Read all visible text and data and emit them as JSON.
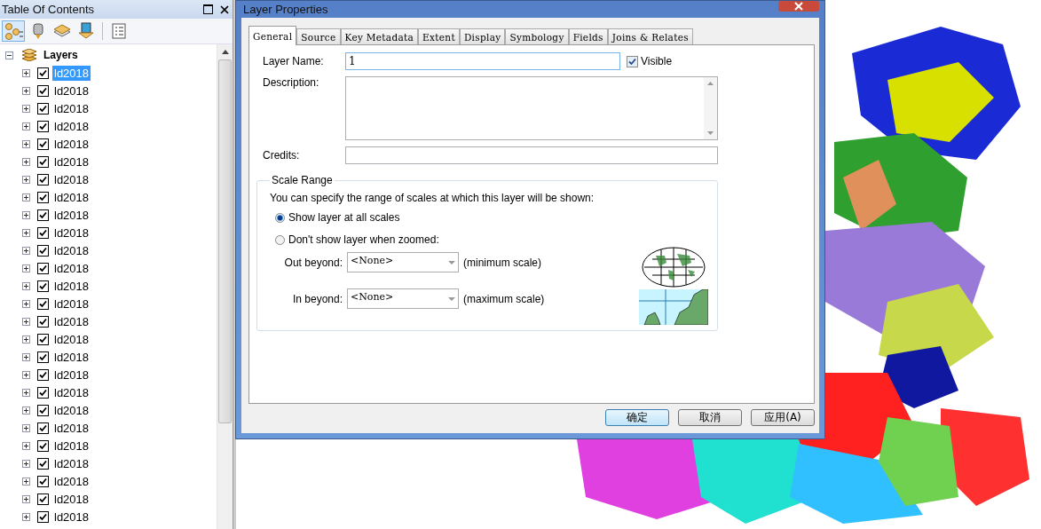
{
  "toc": {
    "title": "Table Of Contents",
    "root": {
      "label": "Layers",
      "expanded": true,
      "children": [
        {
          "label": "ld2018",
          "checked": true,
          "selected": true,
          "expanded": false
        },
        {
          "label": "ld2018",
          "checked": true,
          "selected": false,
          "expanded": false
        },
        {
          "label": "ld2018",
          "checked": true,
          "selected": false,
          "expanded": false
        },
        {
          "label": "ld2018",
          "checked": true,
          "selected": false,
          "expanded": false
        },
        {
          "label": "ld2018",
          "checked": true,
          "selected": false,
          "expanded": false
        },
        {
          "label": "ld2018",
          "checked": true,
          "selected": false,
          "expanded": false
        },
        {
          "label": "ld2018",
          "checked": true,
          "selected": false,
          "expanded": false
        },
        {
          "label": "ld2018",
          "checked": true,
          "selected": false,
          "expanded": false
        },
        {
          "label": "ld2018",
          "checked": true,
          "selected": false,
          "expanded": false
        },
        {
          "label": "ld2018",
          "checked": true,
          "selected": false,
          "expanded": false
        },
        {
          "label": "ld2018",
          "checked": true,
          "selected": false,
          "expanded": false
        },
        {
          "label": "ld2018",
          "checked": true,
          "selected": false,
          "expanded": false
        },
        {
          "label": "ld2018",
          "checked": true,
          "selected": false,
          "expanded": false
        },
        {
          "label": "ld2018",
          "checked": true,
          "selected": false,
          "expanded": false
        },
        {
          "label": "ld2018",
          "checked": true,
          "selected": false,
          "expanded": false
        },
        {
          "label": "ld2018",
          "checked": true,
          "selected": false,
          "expanded": false
        },
        {
          "label": "ld2018",
          "checked": true,
          "selected": false,
          "expanded": false
        },
        {
          "label": "ld2018",
          "checked": true,
          "selected": false,
          "expanded": false
        },
        {
          "label": "ld2018",
          "checked": true,
          "selected": false,
          "expanded": false
        },
        {
          "label": "ld2018",
          "checked": true,
          "selected": false,
          "expanded": false
        },
        {
          "label": "ld2018",
          "checked": true,
          "selected": false,
          "expanded": false
        },
        {
          "label": "ld2018",
          "checked": true,
          "selected": false,
          "expanded": false
        },
        {
          "label": "ld2018",
          "checked": true,
          "selected": false,
          "expanded": false
        },
        {
          "label": "ld2018",
          "checked": true,
          "selected": false,
          "expanded": false
        },
        {
          "label": "ld2018",
          "checked": true,
          "selected": false,
          "expanded": false
        },
        {
          "label": "ld2018",
          "checked": true,
          "selected": false,
          "expanded": false
        }
      ]
    }
  },
  "dialog": {
    "title": "Layer Properties",
    "tabs": [
      {
        "label": "General",
        "selected": true
      },
      {
        "label": "Source",
        "selected": false
      },
      {
        "label": "Key Metadata",
        "selected": false
      },
      {
        "label": "Extent",
        "selected": false
      },
      {
        "label": "Display",
        "selected": false
      },
      {
        "label": "Symbology",
        "selected": false
      },
      {
        "label": "Fields",
        "selected": false
      },
      {
        "label": "Joins & Relates",
        "selected": false
      }
    ],
    "layer_name": {
      "label": "Layer Name:",
      "value": "1"
    },
    "visible": {
      "label": "Visible",
      "checked": true
    },
    "description": {
      "label": "Description:"
    },
    "credits": {
      "label": "Credits:"
    },
    "scale_range": {
      "title": "Scale Range",
      "intro": "You can specify the range of scales at which this layer will be shown:",
      "options": [
        {
          "label": "Show layer at all scales",
          "selected": true
        },
        {
          "label": "Don't show layer when zoomed:",
          "selected": false
        }
      ],
      "out_beyond": {
        "label": "Out beyond:",
        "value": "<None>",
        "note": "(minimum scale)"
      },
      "in_beyond": {
        "label": "In beyond:",
        "value": "<None>",
        "note": "(maximum scale)"
      }
    },
    "buttons": [
      {
        "label": "确定",
        "default": true
      },
      {
        "label": "取消",
        "default": false
      },
      {
        "label": "应用(A)",
        "default": false
      }
    ]
  }
}
